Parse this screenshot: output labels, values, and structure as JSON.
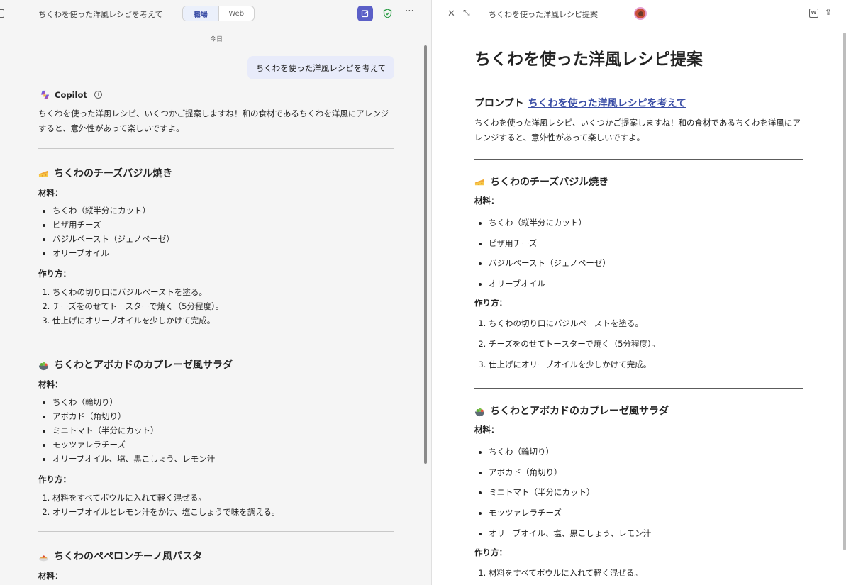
{
  "chat": {
    "title": "ちくわを使った洋風レシピを考えて",
    "toggle": [
      "職場",
      "Web"
    ],
    "date": "今日",
    "user_message": "ちくわを使った洋風レシピを考えて",
    "assistant_name": "Copilot",
    "intro": "ちくわを使った洋風レシピ、いくつかご提案しますね！和の食材であるちくわを洋風にアレンジすると、意外性があって楽しいですよ。",
    "recipes": [
      {
        "title": "ちくわのチーズバジル焼き",
        "ingredients_label": "材料：",
        "ingredients": [
          "ちくわ（縦半分にカット）",
          "ピザ用チーズ",
          "バジルペースト（ジェノベーゼ）",
          "オリーブオイル"
        ],
        "steps_label": "作り方：",
        "steps": [
          "ちくわの切り口にバジルペーストを塗る。",
          "チーズをのせてトースターで焼く（5分程度）。",
          "仕上げにオリーブオイルを少しかけて完成。"
        ]
      },
      {
        "title": "ちくわとアボカドのカプレーゼ風サラダ",
        "ingredients_label": "材料：",
        "ingredients": [
          "ちくわ（輪切り）",
          "アボカド（角切り）",
          "ミニトマト（半分にカット）",
          "モッツァレラチーズ",
          "オリーブオイル、塩、黒こしょう、レモン汁"
        ],
        "steps_label": "作り方：",
        "steps": [
          "材料をすべてボウルに入れて軽く混ぜる。",
          "オリーブオイルとレモン汁をかけ、塩こしょうで味を調える。"
        ]
      },
      {
        "title": "ちくわのペペロンチーノ風パスタ",
        "ingredients_label": "材料："
      }
    ]
  },
  "doc": {
    "header_title": "ちくわを使った洋風レシピ提案",
    "title": "ちくわを使った洋風レシピ提案",
    "prompt_label": "プロンプト",
    "prompt_link": "ちくわを使った洋風レシピを考えて",
    "intro": "ちくわを使った洋風レシピ、いくつかご提案しますね！和の食材であるちくわを洋風にアレンジすると、意外性があって楽しいですよ。",
    "word_icon_letter": "W",
    "recipes": [
      {
        "title": "ちくわのチーズバジル焼き",
        "ingredients_label": "材料：",
        "ingredients": [
          "ちくわ（縦半分にカット）",
          "ピザ用チーズ",
          "バジルペースト（ジェノベーゼ）",
          "オリーブオイル"
        ],
        "steps_label": "作り方：",
        "steps": [
          "ちくわの切り口にバジルペーストを塗る。",
          "チーズをのせてトースターで焼く（5分程度）。",
          "仕上げにオリーブオイルを少しかけて完成。"
        ]
      },
      {
        "title": "ちくわとアボカドのカプレーゼ風サラダ",
        "ingredients_label": "材料：",
        "ingredients": [
          "ちくわ（輪切り）",
          "アボカド（角切り）",
          "ミニトマト（半分にカット）",
          "モッツァレラチーズ",
          "オリーブオイル、塩、黒こしょう、レモン汁"
        ],
        "steps_label": "作り方：",
        "steps": [
          "材料をすべてボウルに入れて軽く混ぜる。"
        ]
      }
    ]
  },
  "icons": {
    "recipe_1": "cheese-icon",
    "recipe_2": "salad-icon",
    "recipe_3": "pasta-icon"
  },
  "colors": {
    "accent": "#5b5fc7",
    "user_bubble": "#e8ebfa",
    "link": "#3b4ea6"
  }
}
